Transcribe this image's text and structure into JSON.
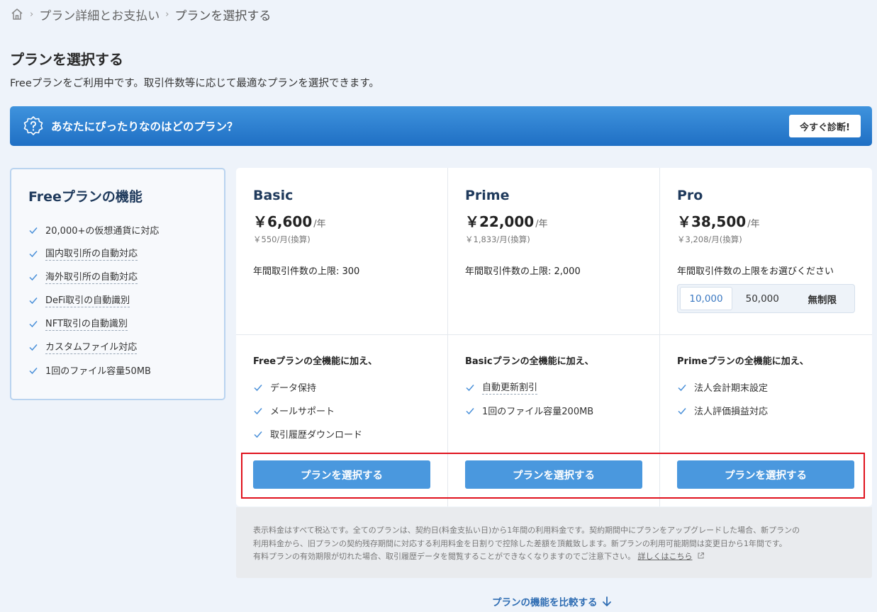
{
  "breadcrumb": {
    "home_icon": "home-icon",
    "items": [
      "プラン詳細とお支払い",
      "プランを選択する"
    ]
  },
  "page": {
    "title": "プランを選択する",
    "description": "Freeプランをご利用中です。取引件数等に応じて最適なプランを選択できます。"
  },
  "banner": {
    "text": "あなたにぴったりなのはどのプラン？",
    "button": "今すぐ診断!",
    "color": "#2d82d3"
  },
  "free_plan": {
    "title": "Freeプランの機能",
    "features": [
      "20,000+の仮想通貨に対応",
      "国内取引所の自動対応",
      "海外取引所の自動対応",
      "DeFi取引の自動識別",
      "NFT取引の自動識別",
      "カスタムファイル対応",
      "1回のファイル容量50MB"
    ]
  },
  "plans": [
    {
      "name": "Basic",
      "price": "￥6,600",
      "unit": "/年",
      "monthly": "￥550/月(換算)",
      "limit": "年間取引件数の上限: 300",
      "features_head": "Freeプランの全機能に加え、",
      "features": [
        "データ保持",
        "メールサポート",
        "取引履歴ダウンロード"
      ],
      "button": "プランを選択する"
    },
    {
      "name": "Prime",
      "price": "￥22,000",
      "unit": "/年",
      "monthly": "￥1,833/月(換算)",
      "limit": "年間取引件数の上限: 2,000",
      "features_head": "Basicプランの全機能に加え、",
      "features": [
        "自動更新割引",
        "1回のファイル容量200MB"
      ],
      "button": "プランを選択する"
    },
    {
      "name": "Pro",
      "price": "￥38,500",
      "unit": "/年",
      "monthly": "￥3,208/月(換算)",
      "limit": "年間取引件数の上限をお選びください",
      "tiers": [
        "10,000",
        "50,000",
        "無制限"
      ],
      "selected_tier": "10,000",
      "features_head": "Primeプランの全機能に加え、",
      "features": [
        "法人会計期末設定",
        "法人評価損益対応"
      ],
      "button": "プランを選択する"
    }
  ],
  "note": {
    "line1": "表示料金はすべて税込です。全てのプランは、契約日(料金支払い日)から1年間の利用料金です。契約期間中にプランをアップグレードした場合、新プランの",
    "line2": "利用料金から、旧プランの契約残存期間に対応する利用料金を日割りで控除した差額を頂戴致します。新プランの利用可能期間は変更日から1年間です。",
    "line3": "有料プランの有効期限が切れた場合、取引履歴データを閲覧することができなくなりますのでご注意下さい。",
    "link": "詳しくはこちら"
  },
  "compare_link": "プランの機能を比較する",
  "colors": {
    "accent": "#4a98de",
    "highlight": "#e0121d"
  }
}
